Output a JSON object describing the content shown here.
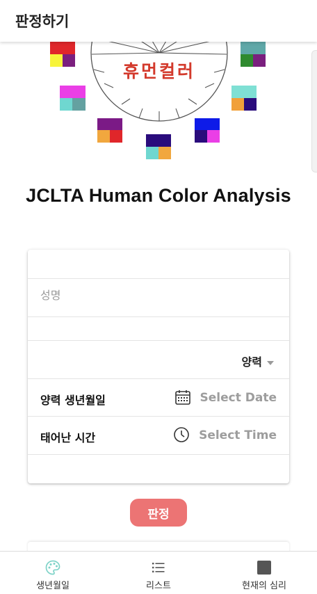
{
  "header": {
    "title": "판정하기"
  },
  "hero": {
    "wheel_text": "휴먼컬러",
    "headline": "JCLTA Human Color Analysis"
  },
  "form": {
    "name_placeholder": "성명",
    "calendar_type": "양력",
    "birth_date_label": "양력 생년월일",
    "birth_date_value": "Select Date",
    "birth_time_label": "태어난 시간",
    "birth_time_value": "Select Time"
  },
  "actions": {
    "judge_label": "판정"
  },
  "bottom_nav": {
    "items": [
      {
        "label": "생년월일",
        "icon": "palette-icon",
        "color": "#7fd3c8"
      },
      {
        "label": "리스트",
        "icon": "list-icon",
        "color": "#555555"
      },
      {
        "label": "현재의 심리",
        "icon": "square-icon",
        "color": "#555555"
      }
    ]
  },
  "colors": {
    "accent_button": "#ec7474",
    "wheel_text": "#d33a2c"
  }
}
